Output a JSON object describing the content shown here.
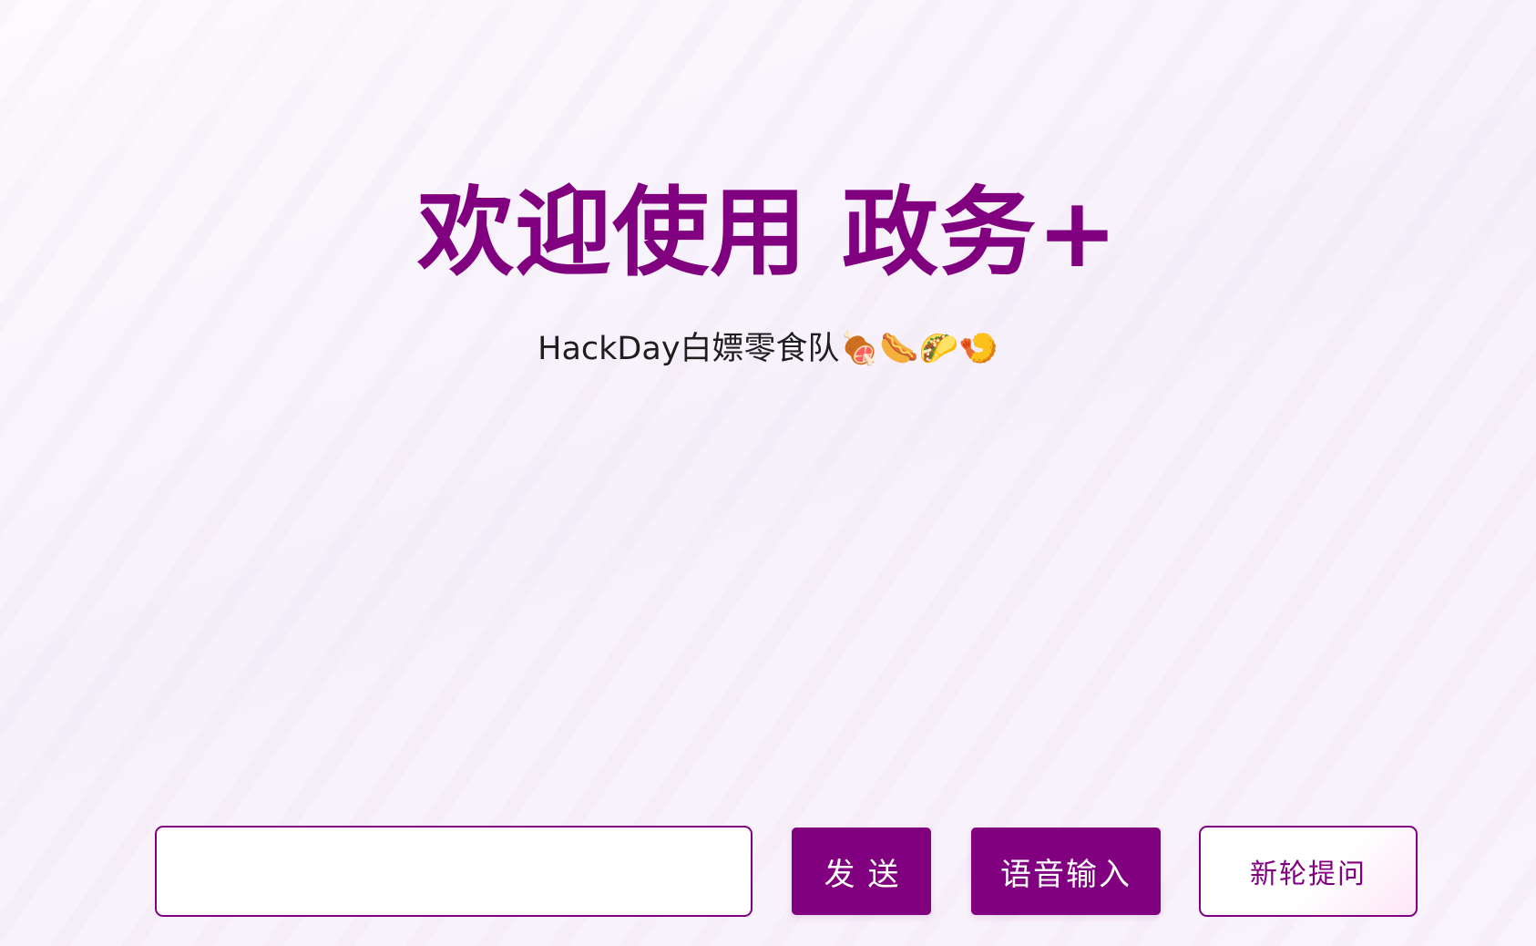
{
  "hero": {
    "title": "欢迎使用 政务+",
    "subtitle": "HackDay白嫖零食队🍖🌭🌮🍤"
  },
  "input_bar": {
    "question_input": {
      "value": "",
      "placeholder": ""
    },
    "send_label": "发送",
    "voice_label": "语音输入",
    "new_round_label": "新轮提问"
  },
  "colors": {
    "accent": "#800080",
    "title": "#800080",
    "subtitle_text": "#1e1e1e",
    "button_text": "#ffffff",
    "background": "#f8f3fb"
  }
}
